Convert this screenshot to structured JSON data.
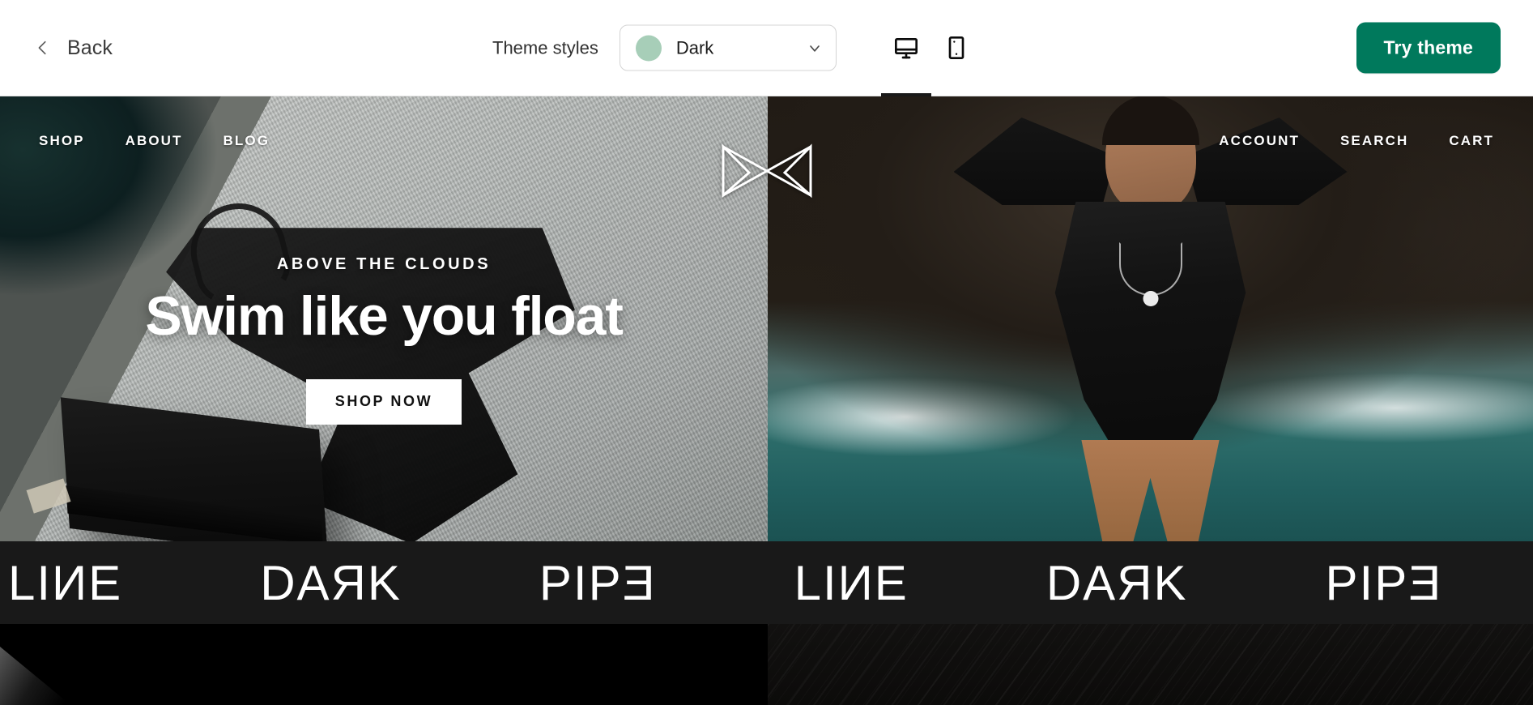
{
  "topbar": {
    "back_label": "Back",
    "back_icon": "chevron-left-icon",
    "theme_styles_label": "Theme styles",
    "theme_selected": "Dark",
    "theme_swatch_color": "#a7ceb8",
    "theme_caret_icon": "chevron-down-icon",
    "devices": [
      {
        "name": "desktop",
        "icon": "desktop-monitor-icon",
        "active": true
      },
      {
        "name": "mobile",
        "icon": "mobile-phone-icon",
        "active": false
      }
    ],
    "try_theme_label": "Try theme",
    "try_theme_color": "#00795c"
  },
  "preview": {
    "store_nav": {
      "left_links": [
        "SHOP",
        "ABOUT",
        "BLOG"
      ],
      "right_links": [
        "ACCOUNT",
        "SEARCH",
        "CART"
      ],
      "logo_icon": "angular-monogram-logo"
    },
    "hero": {
      "eyebrow": "ABOVE THE CLOUDS",
      "title": "Swim like you float",
      "cta_label": "SHOP NOW"
    },
    "marquee": {
      "words": [
        "LIИE",
        "DAЯK",
        "PIPƎ",
        "LIИE",
        "DAЯK",
        "PIPƎ"
      ],
      "background": "#191919",
      "color": "#ffffff"
    }
  }
}
